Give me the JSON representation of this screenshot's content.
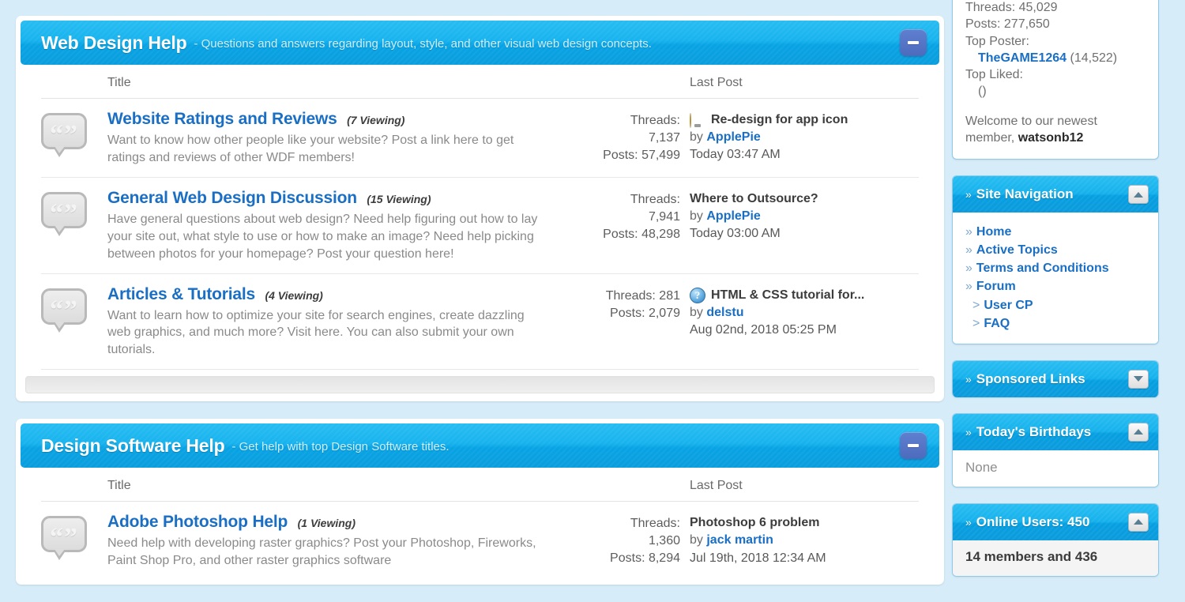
{
  "theme": {
    "page_bg": "#d6ecf8",
    "header_blue": "#18b3ee",
    "link_blue": "#1a6fc4",
    "panel_border": "#8ecbea"
  },
  "forum_sections": [
    {
      "title": "Web Design Help",
      "description": "- Questions and answers regarding layout, style, and other visual web design concepts.",
      "collapse_icon": "minus-icon",
      "columns": {
        "title": "Title",
        "last_post": "Last Post"
      },
      "rows": [
        {
          "icon": "speech-bubble-icon",
          "name": "Website Ratings and Reviews",
          "viewing": "(7 Viewing)",
          "description": "Want to know how other people like your website? Post a link here to get ratings and reviews of other WDF members!",
          "threads_label": "Threads:",
          "threads": "7,137",
          "posts": "Posts: 57,499",
          "last_post_icon": "lightbulb-icon",
          "last_post_title": "Re-design for app icon",
          "last_post_by": "by",
          "last_post_user": "ApplePie",
          "last_post_date": "Today 03:47 AM"
        },
        {
          "icon": "speech-bubble-icon",
          "name": "General Web Design Discussion",
          "viewing": "(15 Viewing)",
          "description": "Have general questions about web design? Need help figuring out how to lay your site out, what style to use or how to make an image? Need help picking between photos for your homepage? Post your question here!",
          "threads_label": "Threads:",
          "threads": "7,941",
          "posts": "Posts: 48,298",
          "last_post_icon": "none",
          "last_post_title": "Where to Outsource?",
          "last_post_by": "by",
          "last_post_user": "ApplePie",
          "last_post_date": "Today 03:00 AM"
        },
        {
          "icon": "speech-bubble-icon",
          "name": "Articles & Tutorials",
          "viewing": "(4 Viewing)",
          "description": "Want to learn how to optimize your site for search engines, create dazzling web graphics, and much more? Visit here. You can also submit your own tutorials.",
          "threads_label": "Threads: 281",
          "threads": "",
          "posts": "Posts: 2,079",
          "last_post_icon": "info-circle-icon",
          "last_post_title": "HTML & CSS tutorial for...",
          "last_post_by": "by",
          "last_post_user": "delstu",
          "last_post_date": "Aug 02nd, 2018 05:25 PM"
        }
      ]
    },
    {
      "title": "Design Software Help",
      "description": "- Get help with top Design Software titles.",
      "collapse_icon": "minus-icon",
      "columns": {
        "title": "Title",
        "last_post": "Last Post"
      },
      "rows": [
        {
          "icon": "speech-bubble-icon",
          "name": "Adobe Photoshop Help",
          "viewing": "(1 Viewing)",
          "description": "Need help with developing raster graphics? Post your Photoshop, Fireworks, Paint Shop Pro, and other raster graphics software",
          "threads_label": "Threads:",
          "threads": "1,360",
          "posts": "Posts: 8,294",
          "last_post_icon": "none",
          "last_post_title": "Photoshop 6 problem",
          "last_post_by": "by",
          "last_post_user": "jack martin",
          "last_post_date": "Jul 19th, 2018 12:34 AM"
        }
      ]
    }
  ],
  "sidebar": {
    "stats": {
      "threads": "Threads: 45,029",
      "posts": "Posts: 277,650",
      "top_poster_label": "Top Poster:",
      "top_poster_name": "TheGAME1264",
      "top_poster_count": "(14,522)",
      "top_liked_label": "Top Liked:",
      "top_liked_value": "()",
      "welcome_prefix": "Welcome to our newest member,",
      "welcome_member": "watsonb12"
    },
    "panels": [
      {
        "title": "Site Navigation",
        "marker": "»",
        "toggle_icon": "chevron-up-icon",
        "collapsed": false,
        "items": [
          {
            "label": "Home",
            "marker": "»",
            "sub": false
          },
          {
            "label": "Active Topics",
            "marker": "»",
            "sub": false
          },
          {
            "label": "Terms and Conditions",
            "marker": "»",
            "sub": false
          },
          {
            "label": "Forum",
            "marker": "»",
            "sub": false
          },
          {
            "label": "User CP",
            "marker": ">",
            "sub": true
          },
          {
            "label": "FAQ",
            "marker": ">",
            "sub": true
          }
        ]
      },
      {
        "title": "Sponsored Links",
        "marker": "»",
        "toggle_icon": "chevron-down-icon",
        "collapsed": true,
        "items": []
      },
      {
        "title": "Today's Birthdays",
        "marker": "»",
        "toggle_icon": "chevron-up-icon",
        "collapsed": false,
        "body_text": "None"
      },
      {
        "title": "Online Users: 450",
        "marker": "»",
        "toggle_icon": "chevron-up-icon",
        "collapsed": false,
        "body_text": "14 members and 436"
      }
    ]
  }
}
